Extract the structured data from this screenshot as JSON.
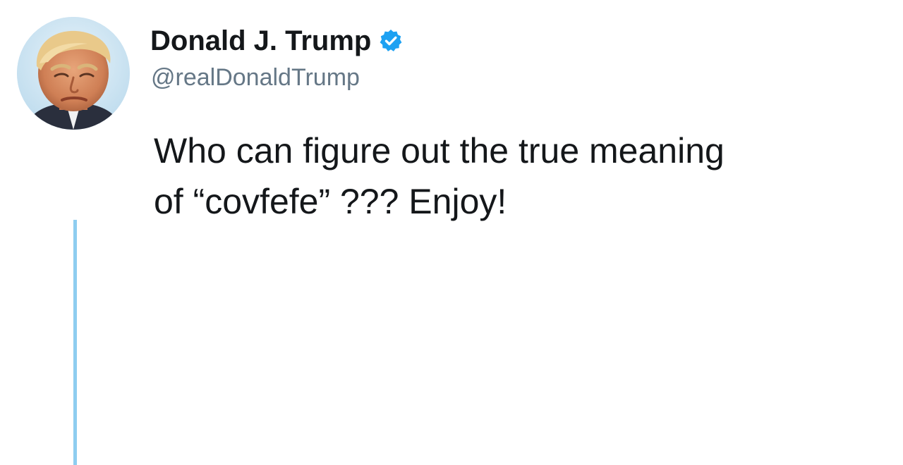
{
  "tweet": {
    "author": {
      "display_name": "Donald J. Trump",
      "handle": "@realDonaldTrump",
      "verified": true,
      "verified_icon": "verified-check-icon",
      "avatar": "profile-photo"
    },
    "text_lines": [
      "Who can figure out the true meaning",
      "of “covfefe” ??? Enjoy!"
    ]
  },
  "colors": {
    "verified_badge": "#1da1f2",
    "thread_line": "#8ecdf0",
    "handle_text": "#657786",
    "body_text": "#14171a"
  }
}
